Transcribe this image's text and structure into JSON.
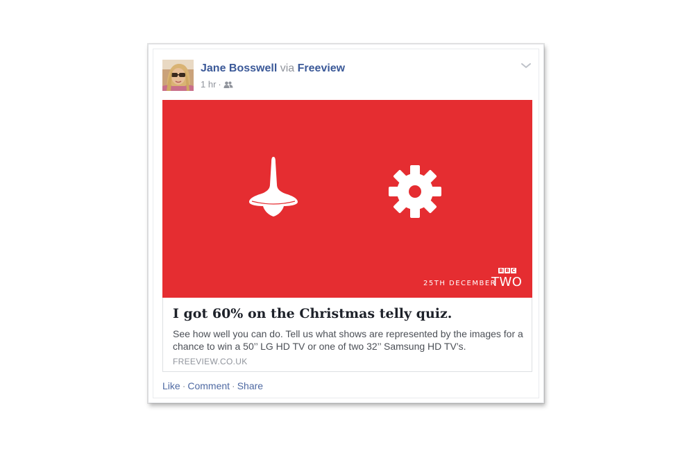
{
  "post": {
    "author": "Jane Bosswell",
    "via_word": "via",
    "app": "Freeview",
    "timestamp": "1 hr",
    "dot": "·",
    "audience_icon": "friends-icon",
    "options_icon": "chevron-down-icon"
  },
  "preview": {
    "image": {
      "background_color": "#e52d31",
      "left_icon": "spinning-top-icon",
      "right_icon": "gear-icon",
      "date_caption": "25TH DECEMBER",
      "channel_logo_letters": [
        "B",
        "B",
        "C"
      ],
      "channel_name": "TWO"
    },
    "title": "I got 60% on the Christmas telly quiz.",
    "description": "See how well you can do. Tell us what shows are represented by the images for a chance to win a 50’’ LG HD TV or one of two 32’’ Samsung HD TV’s.",
    "domain": "FREEVIEW.CO.UK"
  },
  "actions": {
    "like": "Like",
    "comment": "Comment",
    "share": "Share",
    "separator": "·"
  },
  "colors": {
    "link_blue": "#3b5998",
    "meta_gray": "#90949c",
    "hero_red": "#e52d31"
  }
}
